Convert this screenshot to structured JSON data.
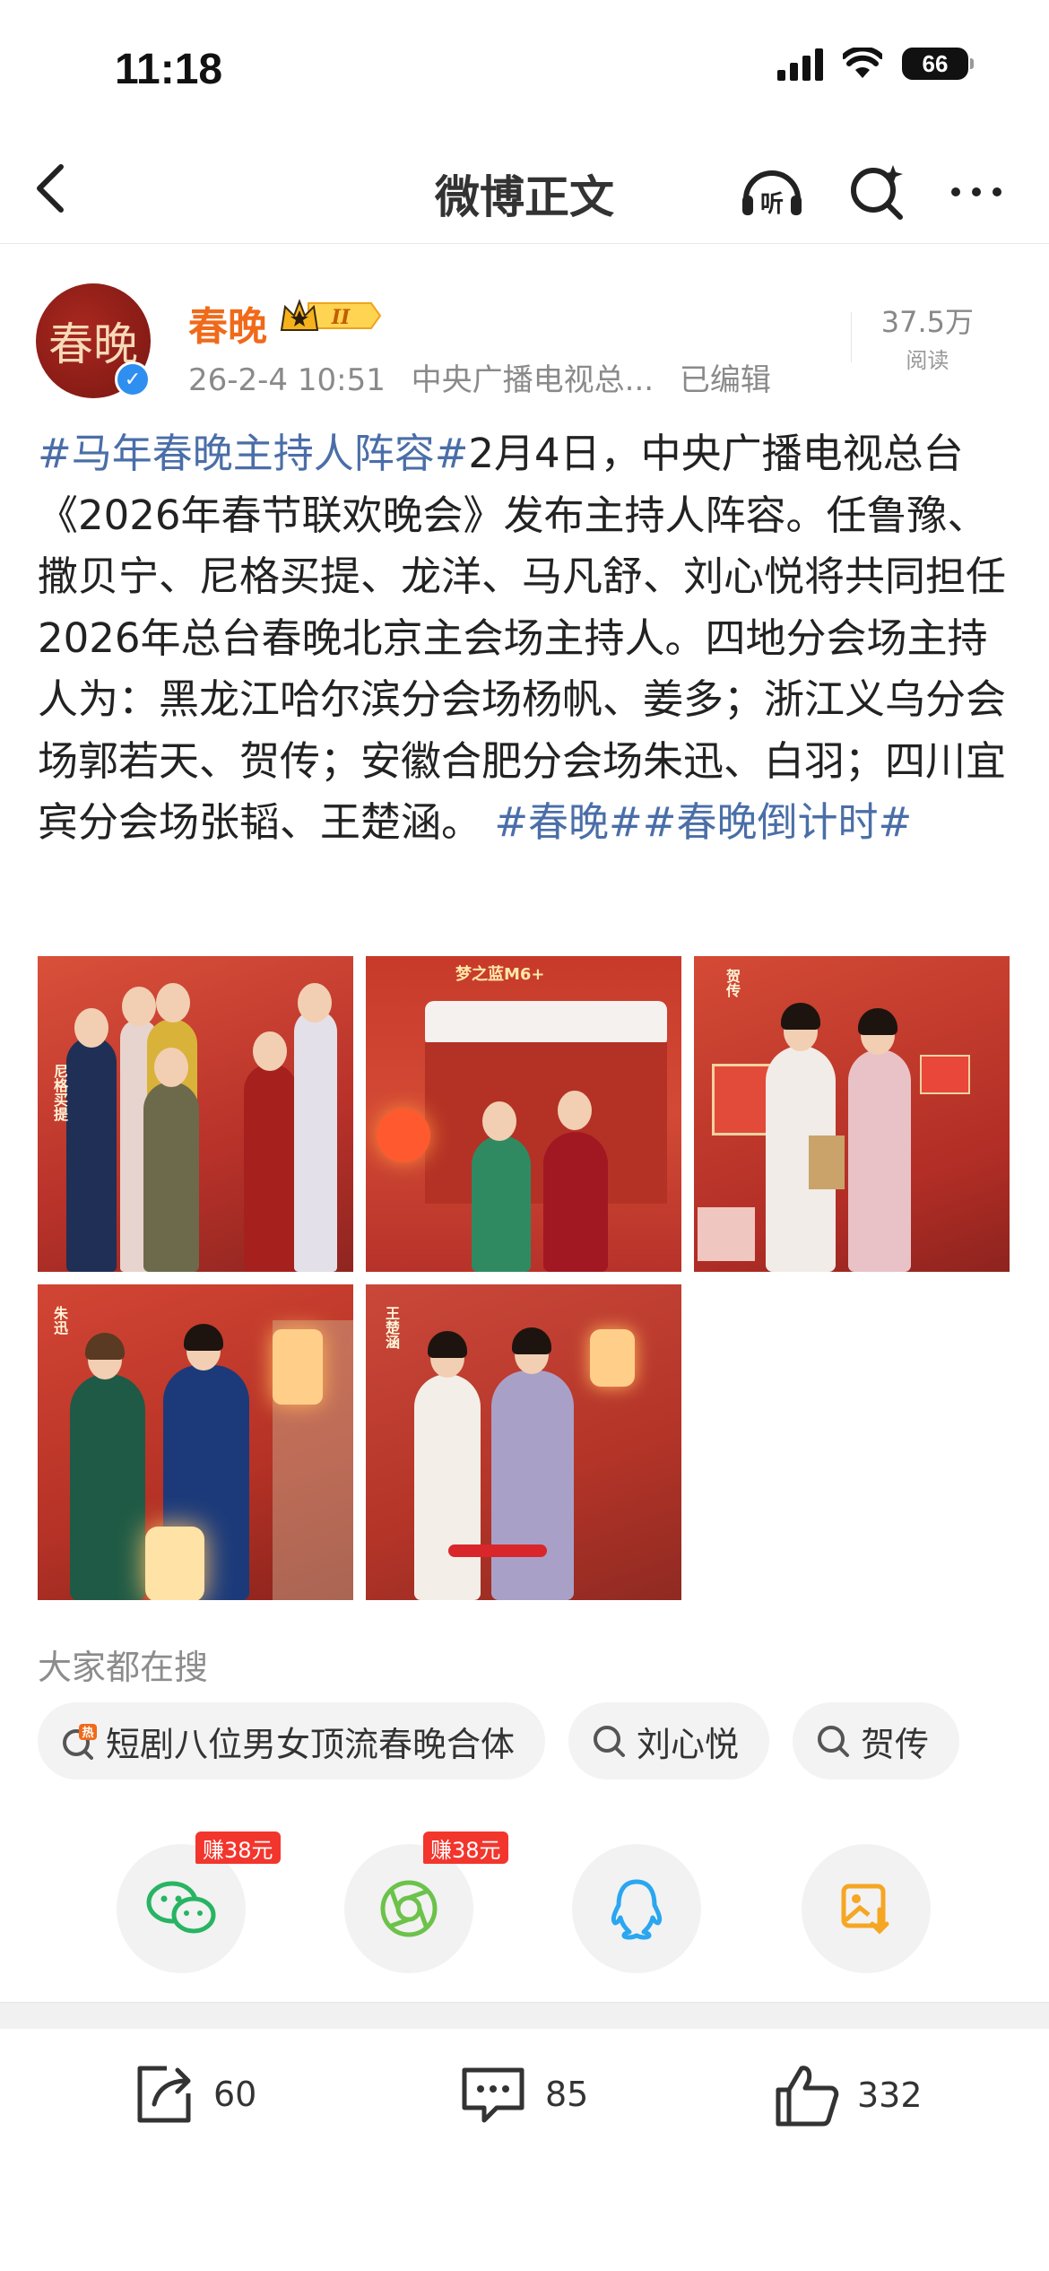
{
  "status_bar": {
    "time": "11:18",
    "battery": "66"
  },
  "nav": {
    "title": "微博正文"
  },
  "post": {
    "author": "春晚",
    "avatar_text": "春晚",
    "timestamp": "26-2-4 10:51",
    "source": "中央广播电视总...",
    "edited": "已编辑",
    "views": "37.5万",
    "views_label": "阅读",
    "text_tag1": "#马年春晚主持人阵容#",
    "text_body": "2月4日，中央广播电视总台《2026年春节联欢晚会》发布主持人阵容。任鲁豫、撒贝宁、尼格买提、龙洋、马凡舒、刘心悦将共同担任2026年总台春晚北京主会场主持人。四地分会场主持人为：黑龙江哈尔滨分会场杨帆、姜多；浙江义乌分会场郭若天、贺传；安徽合肥分会场朱迅、白羽；四川宜宾分会场张韬、王楚涵。",
    "text_tag2": "#春晚#",
    "text_tag3": "#春晚倒计时#"
  },
  "images": [
    {
      "caption": "尼格买提"
    },
    {
      "caption": "梦之蓝M6+"
    },
    {
      "caption": "贺传"
    },
    {
      "caption": "朱迅"
    },
    {
      "caption": "王楚涵"
    }
  ],
  "trending": {
    "label": "大家都在搜",
    "chips": [
      {
        "text": "短剧八位男女顶流春晚合体",
        "icon": "hot-icon"
      },
      {
        "text": "刘心悦",
        "icon": "search-icon"
      },
      {
        "text": "贺传",
        "icon": "search-icon"
      }
    ]
  },
  "share": {
    "wechat_badge": "赚38元",
    "moments_badge": "赚38元"
  },
  "actions": {
    "reposts": "60",
    "comments": "85",
    "likes": "332"
  },
  "colors": {
    "accent": "#f06a1a",
    "tag": "#4a6ea8",
    "badge": "#f2362d"
  }
}
